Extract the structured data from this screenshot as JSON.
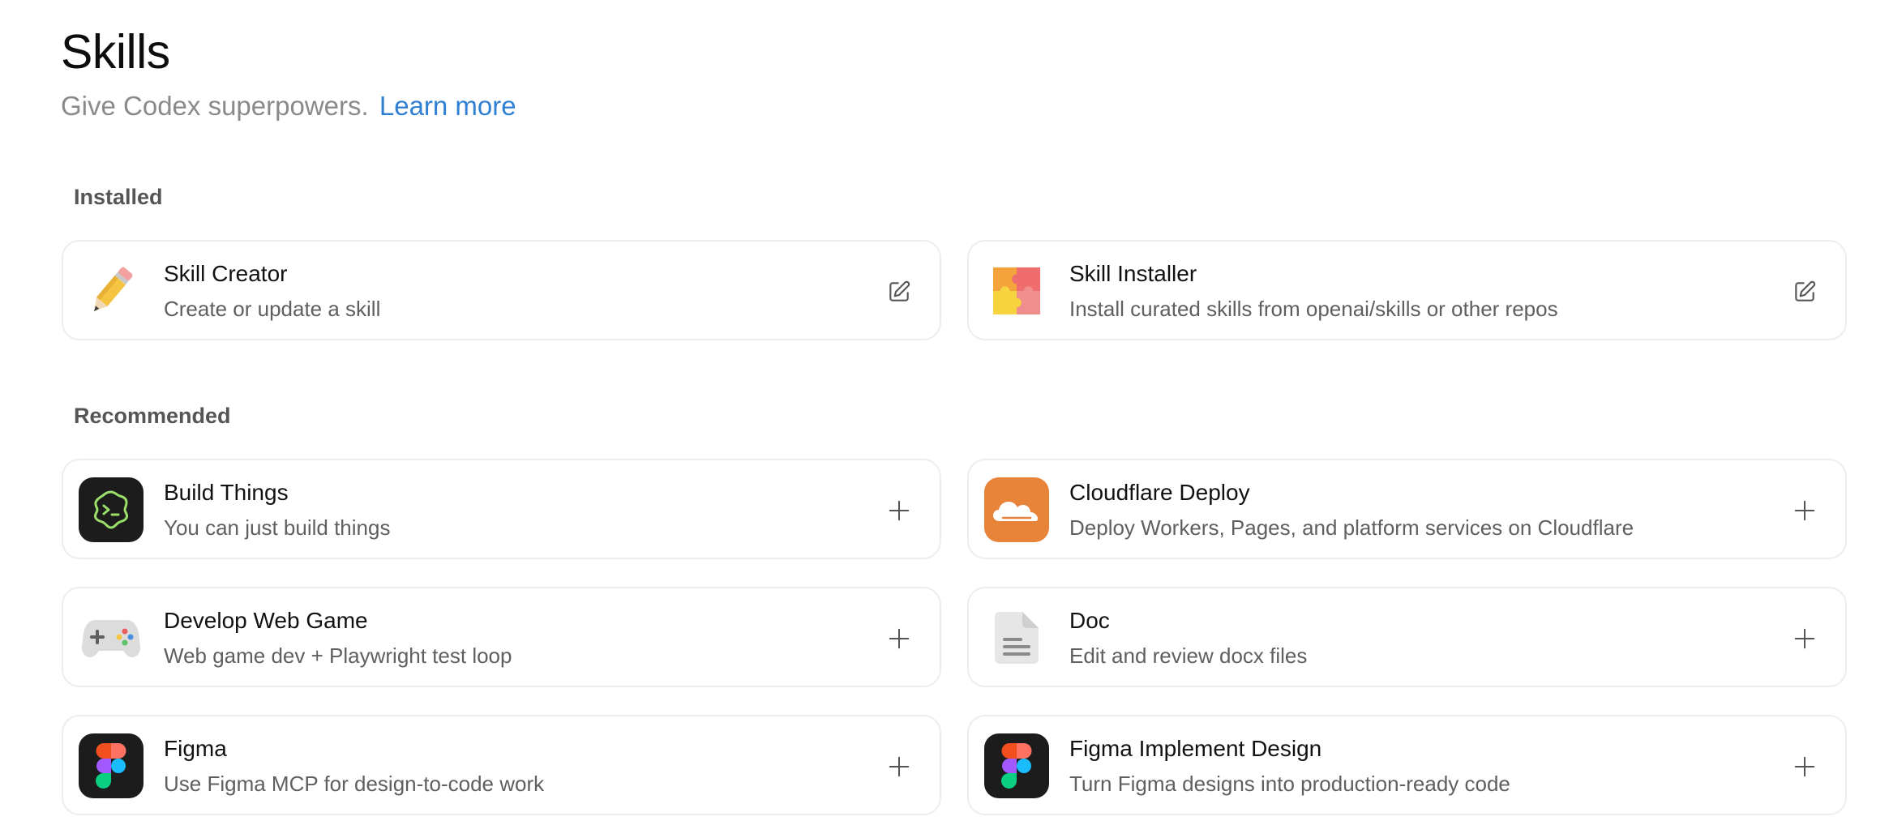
{
  "header": {
    "title": "Skills",
    "subtitle": "Give Codex superpowers.",
    "learn_more": "Learn more"
  },
  "sections": {
    "installed": {
      "label": "Installed",
      "items": [
        {
          "title": "Skill Creator",
          "description": "Create or update a skill",
          "icon": "pencil-icon",
          "action": "edit-icon"
        },
        {
          "title": "Skill Installer",
          "description": "Install curated skills from openai/skills or other repos",
          "icon": "puzzle-icon",
          "action": "edit-icon"
        }
      ]
    },
    "recommended": {
      "label": "Recommended",
      "items": [
        {
          "title": "Build Things",
          "description": "You can just build things",
          "icon": "terminal-blob-icon",
          "action": "plus-icon"
        },
        {
          "title": "Cloudflare Deploy",
          "description": "Deploy Workers, Pages, and platform services on Cloudflare",
          "icon": "cloudflare-icon",
          "action": "plus-icon"
        },
        {
          "title": "Develop Web Game",
          "description": "Web game dev + Playwright test loop",
          "icon": "gamepad-icon",
          "action": "plus-icon"
        },
        {
          "title": "Doc",
          "description": "Edit and review docx files",
          "icon": "document-icon",
          "action": "plus-icon"
        },
        {
          "title": "Figma",
          "description": "Use Figma MCP for design-to-code work",
          "icon": "figma-icon",
          "action": "plus-icon"
        },
        {
          "title": "Figma Implement Design",
          "description": "Turn Figma designs into production-ready code",
          "icon": "figma-icon",
          "action": "plus-icon"
        }
      ]
    }
  },
  "colors": {
    "link": "#2f7fd3",
    "cloudflare": "#e8833a",
    "dark_tile": "#1c1c1c"
  }
}
